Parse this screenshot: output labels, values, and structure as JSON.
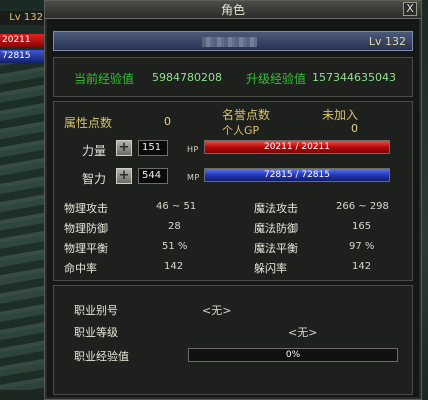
{
  "window": {
    "title": "角色",
    "close_label": "X"
  },
  "mini_status": {
    "level": "Lv 132",
    "hp": "20211",
    "mp": "72815"
  },
  "character": {
    "level": "Lv 132"
  },
  "experience": {
    "current_label": "当前经验值",
    "current_value": "5984780208",
    "next_label": "升级经验值",
    "next_value": "157344635043"
  },
  "points": {
    "attr_label": "属性点数",
    "attr_value": "0",
    "fame_label": "名誉点数",
    "fame_status": "未加入",
    "gp_label": "个人GP",
    "gp_value": "0"
  },
  "strength": {
    "label": "力量",
    "value": "151",
    "bar_label": "HP",
    "bar_text": "20211 / 20211",
    "bar_fraction": 1.0
  },
  "intelligence": {
    "label": "智力",
    "value": "544",
    "bar_label": "MP",
    "bar_text": "72815 / 72815",
    "bar_fraction": 1.0
  },
  "stats": {
    "phys_atk_label": "物理攻击",
    "phys_atk": "46 ~ 51",
    "mag_atk_label": "魔法攻击",
    "mag_atk": "266 ~ 298",
    "phys_def_label": "物理防御",
    "phys_def": "28",
    "mag_def_label": "魔法防御",
    "mag_def": "165",
    "phys_bal_label": "物理平衡",
    "phys_bal": "51 %",
    "mag_bal_label": "魔法平衡",
    "mag_bal": "97 %",
    "hit_label": "命中率",
    "hit": "142",
    "dodge_label": "躲闪率",
    "dodge": "142"
  },
  "job": {
    "alias_label": "职业别号",
    "alias_value": "<无>",
    "level_label": "职业等级",
    "level_value": "<无>",
    "exp_label": "职业经验值",
    "exp_text": "0%",
    "exp_fraction": 0.0
  },
  "colors": {
    "hp": "#b50b0b",
    "mp": "#2638b8",
    "label_green": "#32c232",
    "label_yellow": "#d9c06a"
  }
}
